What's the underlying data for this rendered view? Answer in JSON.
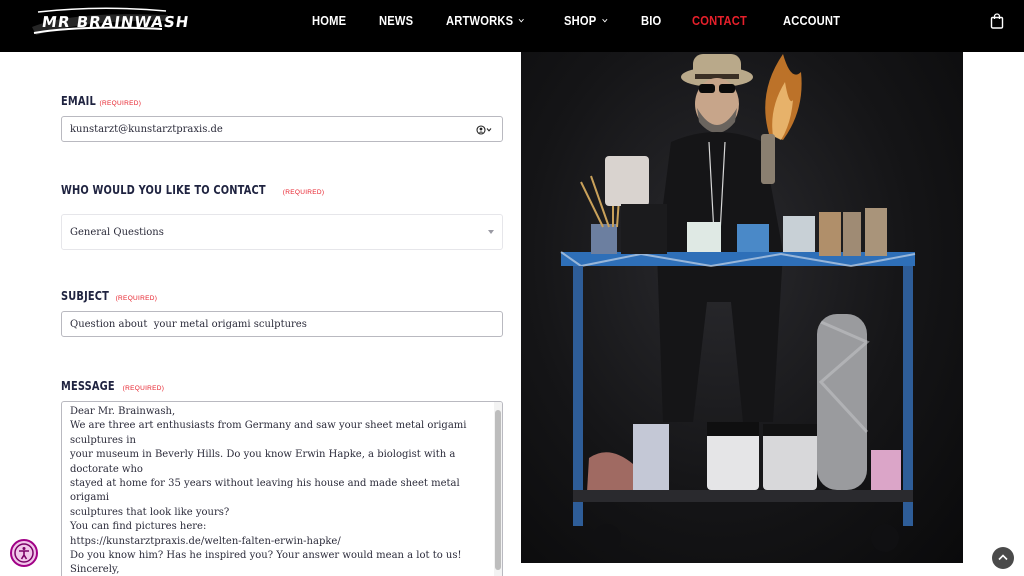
{
  "header": {
    "logo_text": "MR BRAINWASH",
    "nav": [
      {
        "label": "HOME",
        "has_dropdown": false,
        "active": false
      },
      {
        "label": "NEWS",
        "has_dropdown": false,
        "active": false
      },
      {
        "label": "ARTWORKS",
        "has_dropdown": true,
        "active": false
      },
      {
        "label": "SHOP",
        "has_dropdown": true,
        "active": false
      },
      {
        "label": "BIO",
        "has_dropdown": false,
        "active": false
      },
      {
        "label": "CONTACT",
        "has_dropdown": false,
        "active": true
      },
      {
        "label": "ACCOUNT",
        "has_dropdown": false,
        "active": false
      }
    ],
    "cart_icon": "shopping-bag-icon"
  },
  "form": {
    "required_text": "(REQUIRED)",
    "email": {
      "label": "EMAIL",
      "value": "kunstarzt@kunstarztpraxis.de",
      "autofill_icon": "contact-autofill-icon"
    },
    "contact": {
      "label": "WHO WOULD YOU LIKE TO CONTACT",
      "value": "General Questions"
    },
    "subject": {
      "label": "SUBJECT",
      "value": "Question about  your metal origami sculptures"
    },
    "message": {
      "label": "MESSAGE",
      "lines": [
        "Dear Mr. Brainwash,",
        "We are three art enthusiasts from Germany and saw your sheet metal origami sculptures in",
        "your museum in Beverly Hills. Do you know Erwin Hapke, a biologist with a doctorate who",
        "stayed at home for 35 years without leaving his house and made sheet metal origami",
        "sculptures that look like yours?",
        "",
        "You can find pictures here:",
        "https://kunstarztpraxis.de/welten-falten-erwin-hapke/",
        "",
        "Do you know him? Has he inspired you? Your answer would mean a lot to us!",
        "",
        "Sincerely,"
      ]
    }
  },
  "photo": {
    "subject": "artist-with-spray-can-photo"
  },
  "widgets": {
    "accessibility_icon": "accessibility-icon",
    "scroll_top_icon": "arrow-up-icon"
  },
  "colors": {
    "accent": "#e7202b",
    "header_bg": "#000000",
    "label": "#1f2340"
  }
}
